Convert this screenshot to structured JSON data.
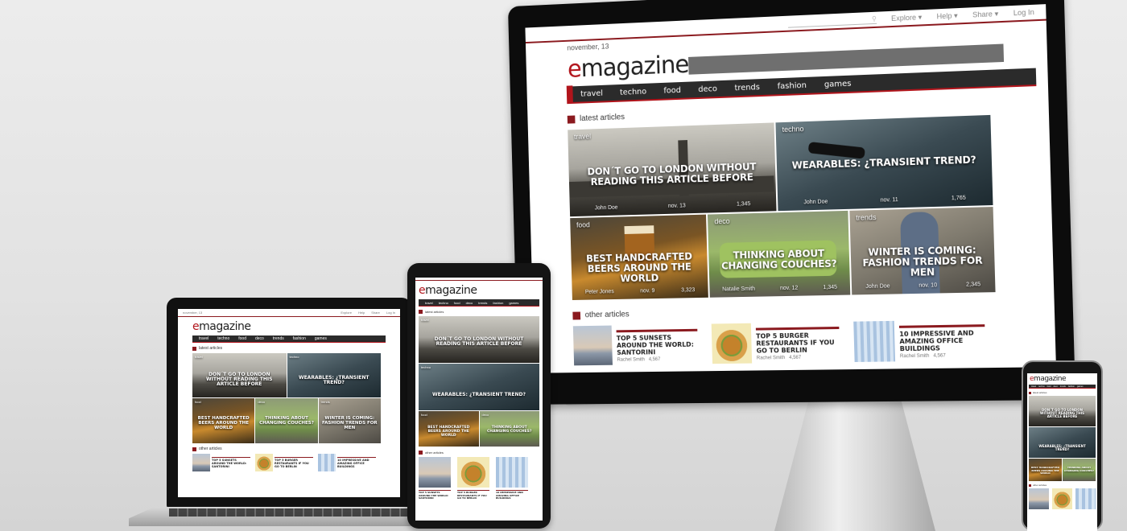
{
  "site": {
    "brand_prefix": "e",
    "brand_rest": "magazine",
    "date": "november, 13",
    "search_placeholder": "",
    "top_links": [
      "Explore ▾",
      "Help ▾",
      "Share ▾",
      "Log In"
    ],
    "nav": [
      "travel",
      "techno",
      "food",
      "deco",
      "trends",
      "fashion",
      "games"
    ],
    "latest_title": "latest articles",
    "other_title": "other articles"
  },
  "latest": [
    {
      "category": "travel",
      "title": "Don´t go to London without reading this article before",
      "author": "John Doe",
      "date": "nov. 13",
      "views": "1,345"
    },
    {
      "category": "techno",
      "title": "Wearables: ¿transient trend?",
      "author": "John Doe",
      "date": "nov. 11",
      "views": "1,765"
    },
    {
      "category": "food",
      "title": "Best handcrafted beers around the world",
      "author": "Peter Jones",
      "date": "nov. 9",
      "views": "3,323"
    },
    {
      "category": "deco",
      "title": "Thinking about changing couches?",
      "author": "Natalie Smith",
      "date": "nov. 12",
      "views": "1,345"
    },
    {
      "category": "trends",
      "title": "Winter is coming: fashion trends for men",
      "author": "John Doe",
      "date": "nov. 10",
      "views": "2,345"
    }
  ],
  "other": [
    {
      "title": "Top 5 sunsets around the world: Santorini",
      "author": "Rachel Smith",
      "views": "4,567"
    },
    {
      "title": "Top 5 burger restaurants if you go to Berlin",
      "author": "Rachel Smith",
      "views": "4,567"
    },
    {
      "title": "10 impressive and amazing office buildings",
      "author": "Rachel Smith",
      "views": "4,567"
    }
  ],
  "laptop": {
    "date": "november, 13",
    "top_links": [
      "Explore",
      "Help",
      "Share",
      "Log In"
    ]
  },
  "colors": {
    "brand_red": "#b1141b",
    "nav_dark": "#2b2b2b",
    "accent_maroon": "#8b1a1f"
  }
}
